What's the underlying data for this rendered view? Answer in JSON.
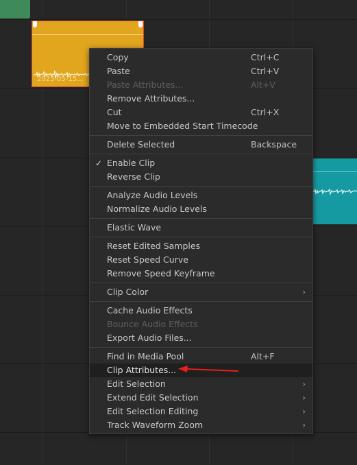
{
  "timeline": {
    "clip_yellow": {
      "name": "2023-05-15...",
      "color": "#e1a51e"
    },
    "clip_teal": {
      "color": "#169aa1"
    },
    "clip_green": {
      "color": "#3f8a5a"
    }
  },
  "context_menu": {
    "copy": {
      "label": "Copy",
      "shortcut": "Ctrl+C"
    },
    "paste": {
      "label": "Paste",
      "shortcut": "Ctrl+V"
    },
    "paste_attributes": {
      "label": "Paste Attributes...",
      "shortcut": "Alt+V"
    },
    "remove_attributes": {
      "label": "Remove Attributes..."
    },
    "cut": {
      "label": "Cut",
      "shortcut": "Ctrl+X"
    },
    "move_to_start_tc": {
      "label": "Move to Embedded Start Timecode"
    },
    "delete_selected": {
      "label": "Delete Selected",
      "shortcut": "Backspace"
    },
    "enable_clip": {
      "label": "Enable Clip",
      "checked": true
    },
    "reverse_clip": {
      "label": "Reverse Clip"
    },
    "analyze_audio": {
      "label": "Analyze Audio Levels"
    },
    "normalize_audio": {
      "label": "Normalize Audio Levels"
    },
    "elastic_wave": {
      "label": "Elastic Wave"
    },
    "reset_edited_samples": {
      "label": "Reset Edited Samples"
    },
    "reset_speed_curve": {
      "label": "Reset Speed Curve"
    },
    "remove_speed_keyframe": {
      "label": "Remove Speed Keyframe"
    },
    "clip_color": {
      "label": "Clip Color"
    },
    "cache_audio_effects": {
      "label": "Cache Audio Effects"
    },
    "bounce_audio_effects": {
      "label": "Bounce Audio Effects"
    },
    "export_audio_files": {
      "label": "Export Audio Files..."
    },
    "find_in_media_pool": {
      "label": "Find in Media Pool",
      "shortcut": "Alt+F"
    },
    "clip_attributes": {
      "label": "Clip Attributes..."
    },
    "edit_selection": {
      "label": "Edit Selection"
    },
    "extend_edit_selection": {
      "label": "Extend Edit Selection"
    },
    "edit_selection_editing": {
      "label": "Edit Selection Editing"
    },
    "track_waveform_zoom": {
      "label": "Track Waveform Zoom"
    }
  },
  "icons": {
    "check": "✓",
    "submenu_arrow": "›"
  },
  "annotation": {
    "arrow_color": "#e8201c"
  }
}
